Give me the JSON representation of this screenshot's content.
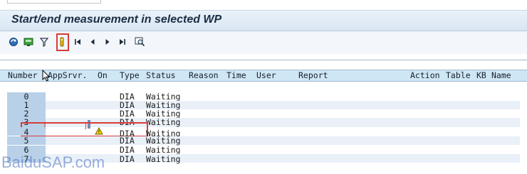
{
  "window": {
    "title": "Start/end measurement in selected WP"
  },
  "toolbar": {
    "buttons": [
      {
        "icon": "refresh-icon"
      },
      {
        "icon": "save-variant-icon"
      },
      {
        "icon": "filter-icon"
      },
      {
        "icon": "measurement-toggle-icon",
        "highlighted": true
      },
      {
        "icon": "first-page-icon"
      },
      {
        "icon": "previous-page-icon"
      },
      {
        "icon": "next-page-icon"
      },
      {
        "icon": "last-page-icon"
      },
      {
        "icon": "find-icon"
      }
    ]
  },
  "table": {
    "headers": [
      "Number",
      "AppSrvr.",
      "On",
      "Type",
      "Status",
      "Reason",
      "Time",
      "User",
      "Report",
      "Action",
      "Table",
      "KB",
      "Name"
    ],
    "rows": [
      {
        "number": "0",
        "type": "DIA",
        "status": "Waiting"
      },
      {
        "number": "1",
        "type": "DIA",
        "status": "Waiting"
      },
      {
        "number": "2",
        "type": "DIA",
        "status": "Waiting"
      },
      {
        "number": "3",
        "type": "DIA",
        "status": "Waiting",
        "warning": true,
        "highlighted": true
      },
      {
        "number": "4",
        "type": "DIA",
        "status": "Waiting"
      },
      {
        "number": "5",
        "type": "DIA",
        "status": "Waiting"
      },
      {
        "number": "6",
        "type": "DIA",
        "status": "Waiting"
      },
      {
        "number": "7",
        "type": "DIA",
        "status": "Waiting"
      }
    ]
  },
  "watermark": "BaiduSAP.com",
  "colors": {
    "highlight": "#d93a3a",
    "header_bg": "#cfe6f5",
    "number_col_bg": "#b8d0e8",
    "title_bg": "#dde9f5"
  }
}
